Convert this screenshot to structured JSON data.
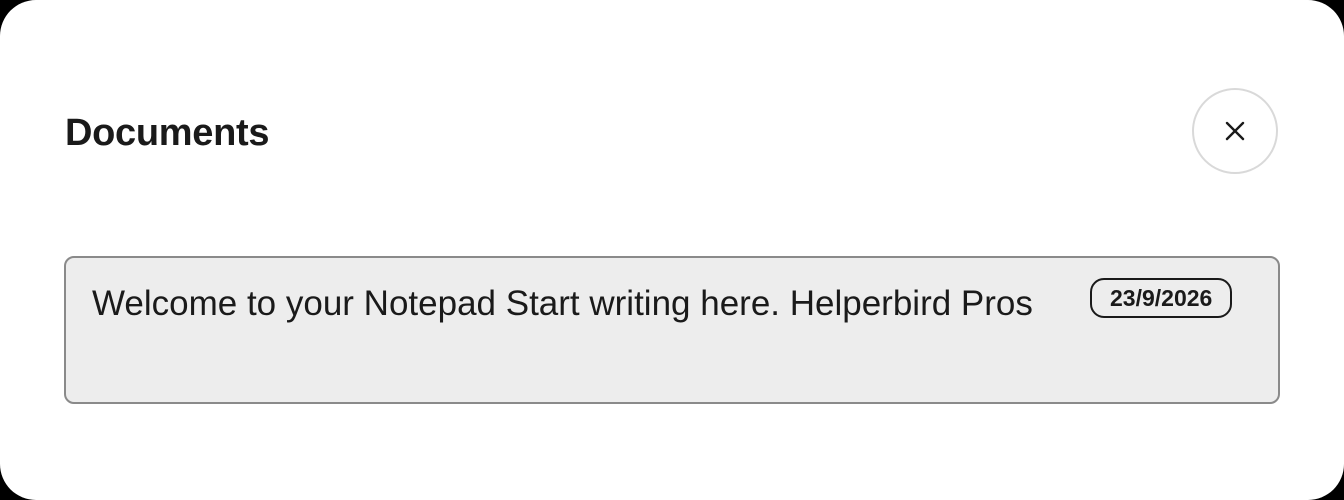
{
  "dialog": {
    "title": "Documents",
    "close_icon": "close-icon"
  },
  "documents": [
    {
      "preview": "Welcome to your Notepad Start writing here. Helperbird Pros",
      "date": "23/9/2026"
    }
  ],
  "colors": {
    "background": "#ffffff",
    "card_background": "#ededed",
    "card_border": "#8a8a8a",
    "text": "#1a1a1a",
    "close_border": "#d9d9d9"
  }
}
